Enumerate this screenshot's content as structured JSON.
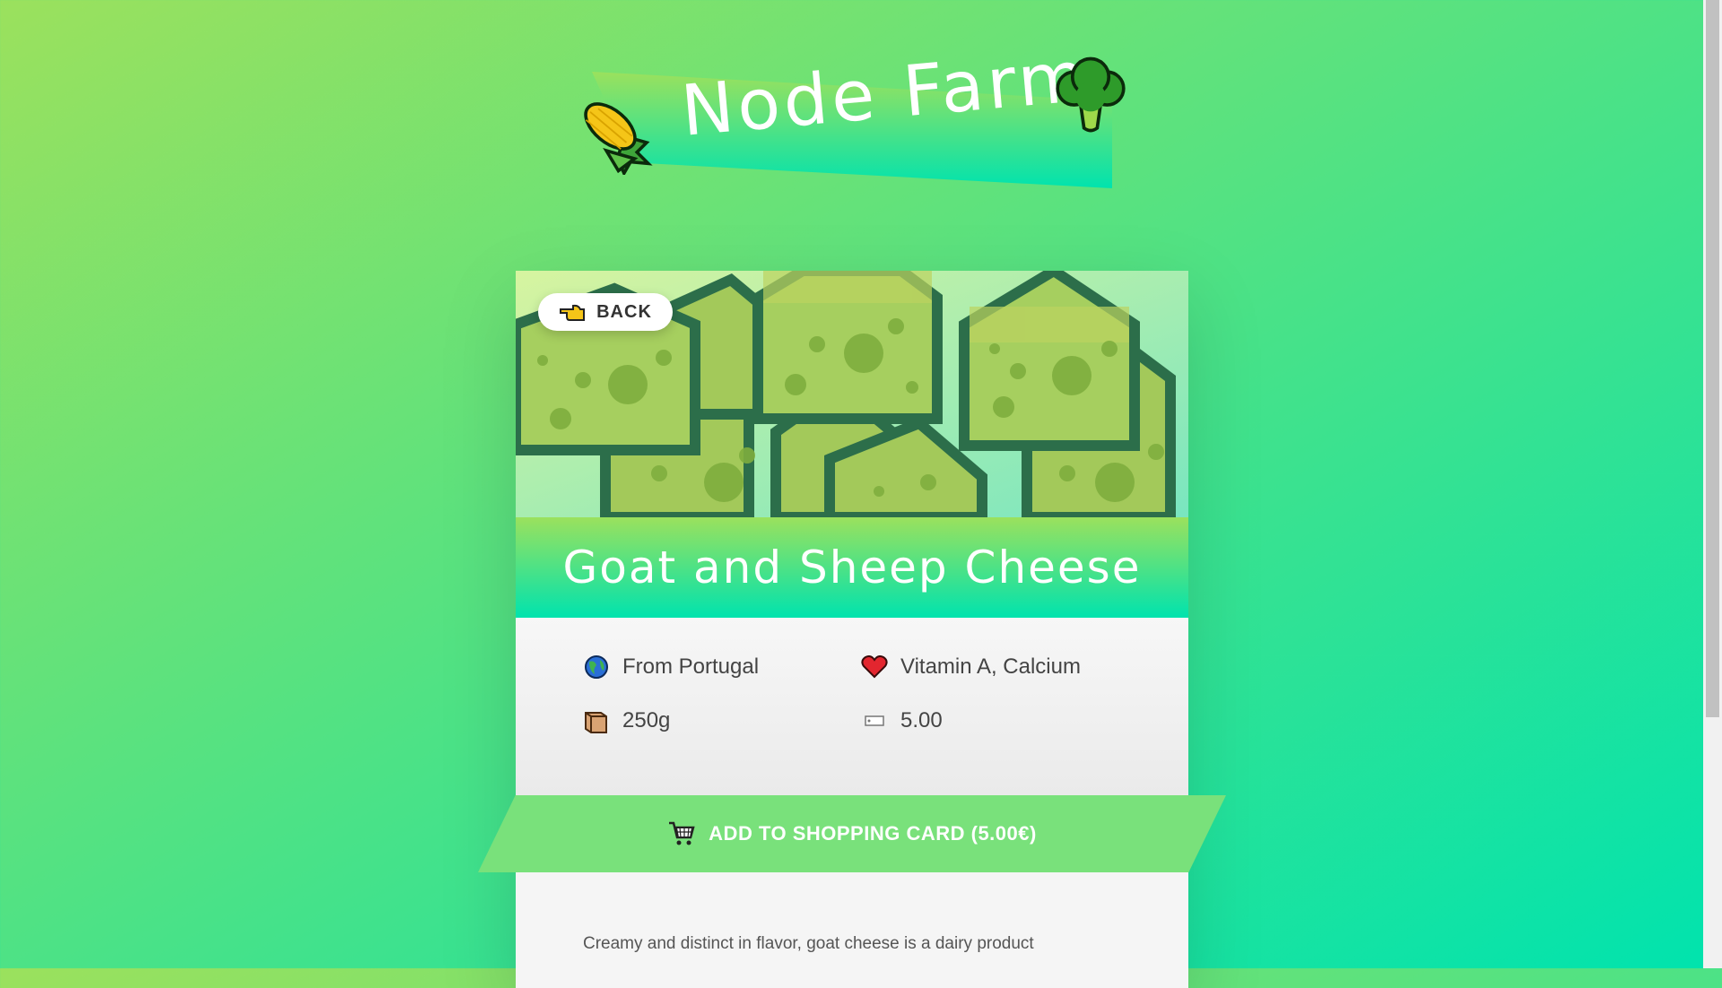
{
  "header": {
    "logo_text": "Node Farm",
    "left_icon": "corn-icon",
    "right_icon": "broccoli-icon"
  },
  "product": {
    "back_label": "BACK",
    "back_icon": "pointing-hand-icon",
    "name": "Goat and Sheep Cheese",
    "image_icon": "cheese-image",
    "origin_text": "From Portugal",
    "nutrients_text": "Vitamin A, Calcium",
    "quantity_text": "250g",
    "price_text": "5.00",
    "cart_label": "ADD TO SHOPPING CARD (5.00€)",
    "description_line1": "Creamy and distinct in flavor, goat cheese is a dairy product"
  },
  "colors": {
    "gradient_start": "#9be15d",
    "gradient_end": "#00e3ae",
    "cart_button": "#79e17b"
  }
}
